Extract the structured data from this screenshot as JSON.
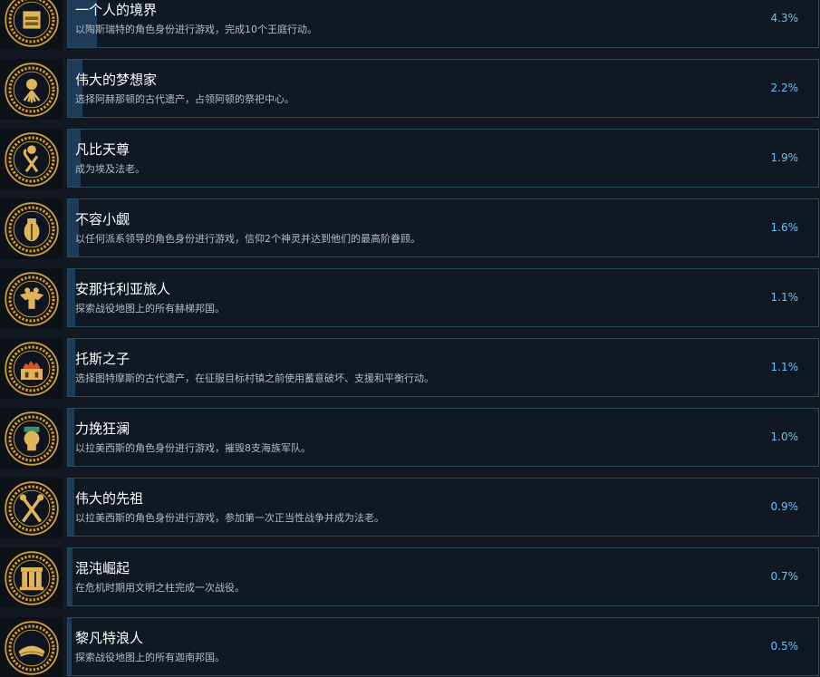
{
  "colors": {
    "background": "#121923",
    "card_border": "#2c4a5e",
    "progress_fill": "#1e3b57",
    "title": "#ffffff",
    "description": "#b3bcc6",
    "percent": "#67c1f5",
    "icon_gold": "#c9a04a"
  },
  "achievements": [
    {
      "icon": "hand-scale-icon",
      "title": "一个人的境界",
      "description": "以陶斯瑞特的角色身份进行游戏，完成10个王庭行动。",
      "percent": "4.3%",
      "unlock_fraction": 0.043
    },
    {
      "icon": "sun-disc-icon",
      "title": "伟大的梦想家",
      "description": "选择阿赫那顿的古代遗产，占领阿顿的祭祀中心。",
      "percent": "2.2%",
      "unlock_fraction": 0.022
    },
    {
      "icon": "crook-flail-icon",
      "title": "凡比天尊",
      "description": "成为埃及法老。",
      "percent": "1.9%",
      "unlock_fraction": 0.019
    },
    {
      "icon": "scarab-icon",
      "title": "不容小觑",
      "description": "以任何派系领导的角色身份进行游戏，信仰2个神灵并达到他们的最高阶眷顾。",
      "percent": "1.6%",
      "unlock_fraction": 0.016
    },
    {
      "icon": "double-eagle-icon",
      "title": "安那托利亚旅人",
      "description": "探索战役地图上的所有赫梯邦国。",
      "percent": "1.1%",
      "unlock_fraction": 0.011
    },
    {
      "icon": "burning-building-icon",
      "title": "托斯之子",
      "description": "选择图特摩斯的古代遗产，在征服目标村镇之前使用蓄意破坏、支援和平衡行动。",
      "percent": "1.1%",
      "unlock_fraction": 0.011
    },
    {
      "icon": "warrior-head-icon",
      "title": "力挽狂澜",
      "description": "以拉美西斯的角色身份进行游戏，摧毁8支海族军队。",
      "percent": "1.0%",
      "unlock_fraction": 0.01
    },
    {
      "icon": "crossed-scepters-icon",
      "title": "伟大的先祖",
      "description": "以拉美西斯的角色身份进行游戏，参加第一次正当性战争并成为法老。",
      "percent": "0.9%",
      "unlock_fraction": 0.009
    },
    {
      "icon": "pillars-icon",
      "title": "混沌崛起",
      "description": "在危机时期用文明之柱完成一次战役。",
      "percent": "0.7%",
      "unlock_fraction": 0.007
    },
    {
      "icon": "crown-icon",
      "title": "黎凡特浪人",
      "description": "探索战役地图上的所有迦南邦国。",
      "percent": "0.5%",
      "unlock_fraction": 0.005
    }
  ]
}
